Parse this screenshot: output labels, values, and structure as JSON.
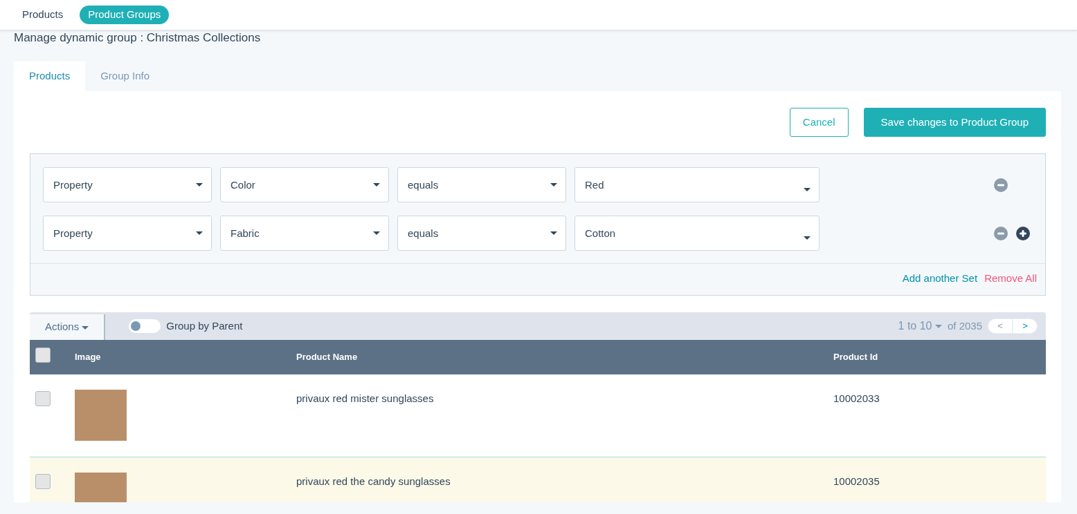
{
  "top_nav": [
    {
      "label": "Products",
      "selected": false
    },
    {
      "label": "Product Groups",
      "selected": true
    }
  ],
  "page_title": "Manage dynamic group : Christmas Collections",
  "tabs": [
    {
      "label": "Products",
      "selected": true
    },
    {
      "label": "Group Info",
      "selected": false
    }
  ],
  "buttons": [
    {
      "label": "Cancel",
      "kind": "outline"
    },
    {
      "label": "Save changes to Product Group",
      "kind": "primary"
    }
  ],
  "filters": [
    {
      "values": [
        "Property",
        "Color",
        "equals",
        "Red"
      ],
      "can_add": false
    },
    {
      "values": [
        "Property",
        "Fabric",
        "equals",
        "Cotton"
      ],
      "can_add": true
    }
  ],
  "filter_links": [
    {
      "label": "Add another Set",
      "kind": "add"
    },
    {
      "label": "Remove All",
      "kind": "remove"
    }
  ],
  "toolbar": {
    "actions": "Actions",
    "group_by_parent": {
      "label": "Group by Parent",
      "on": false
    },
    "range": "1 to 10",
    "total": "of 2035",
    "prev": {
      "label": "<",
      "disabled": true
    },
    "next": {
      "label": ">",
      "disabled": false
    }
  },
  "table": {
    "header_checked": false,
    "columns": [
      "Image",
      "Product Name",
      "Product Id"
    ],
    "rows": [
      {
        "checked": false,
        "hovered": false,
        "name": "privaux red mister sunglasses",
        "id": "10002033"
      },
      {
        "checked": false,
        "hovered": true,
        "name": "privaux red the candy sunglasses",
        "id": "10002035"
      }
    ]
  }
}
